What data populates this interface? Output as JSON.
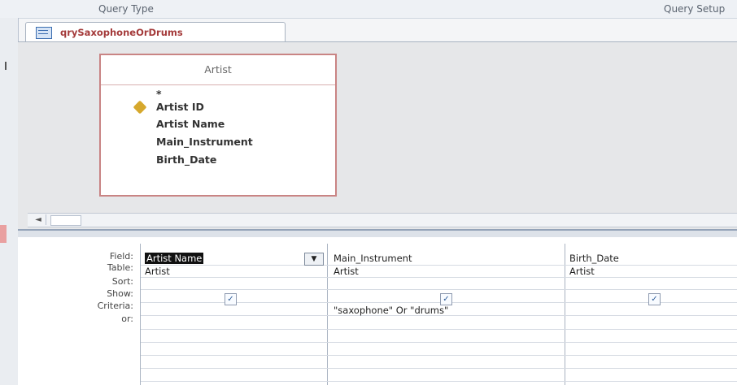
{
  "ribbon": {
    "query_type": "Query Type",
    "query_setup": "Query Setup"
  },
  "tab": {
    "label": "qrySaxophoneOrDrums",
    "icon": "query-icon"
  },
  "table": {
    "name": "Artist",
    "fields": [
      "*",
      "Artist ID",
      "Artist Name",
      "Main_Instrument",
      "Birth_Date"
    ],
    "primary_key": "Artist ID"
  },
  "scroll": {
    "left_arrow": "◄"
  },
  "grid": {
    "row_labels": [
      "Field:",
      "Table:",
      "Sort:",
      "Show:",
      "Criteria:",
      "or:"
    ],
    "columns": [
      {
        "field": "Artist Name",
        "table": "Artist",
        "sort": "",
        "show": true,
        "criteria": "",
        "or": ""
      },
      {
        "field": "Main_Instrument",
        "table": "Artist",
        "sort": "",
        "show": true,
        "criteria": "\"saxophone\" Or \"drums\"",
        "or": ""
      },
      {
        "field": "Birth_Date",
        "table": "Artist",
        "sort": "",
        "show": true,
        "criteria": "",
        "or": ""
      }
    ],
    "dropdown_icon": "▼",
    "check_mark": "✓"
  }
}
